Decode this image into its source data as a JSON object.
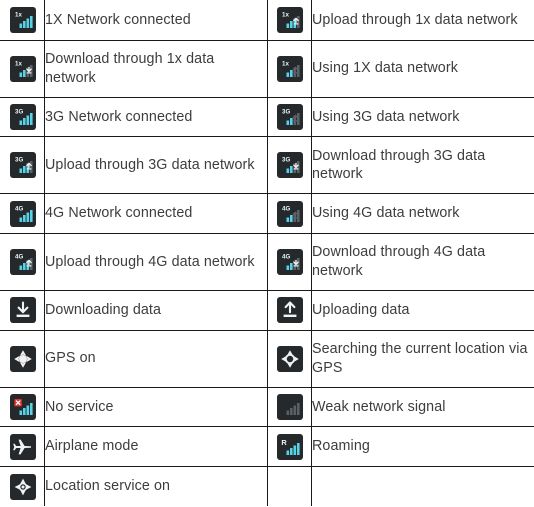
{
  "table": {
    "columns": [
      "icon",
      "description",
      "icon",
      "description"
    ],
    "rows": [
      {
        "left": {
          "icon": "signal-bars-1x-connected-icon",
          "badge": "1x",
          "label": "1X Network connected"
        },
        "right": {
          "icon": "signal-bars-1x-upload-icon",
          "badge": "1x",
          "label": "Upload through 1x data network"
        }
      },
      {
        "left": {
          "icon": "signal-bars-1x-download-icon",
          "badge": "1x",
          "label": "Download through 1x data network"
        },
        "right": {
          "icon": "signal-bars-1x-idle-icon",
          "badge": "1x",
          "label": "Using 1X data network"
        }
      },
      {
        "left": {
          "icon": "signal-bars-3g-connected-icon",
          "badge": "3G",
          "label": "3G Network connected"
        },
        "right": {
          "icon": "signal-bars-3g-idle-icon",
          "badge": "3G",
          "label": "Using 3G data network"
        }
      },
      {
        "left": {
          "icon": "signal-bars-3g-upload-icon",
          "badge": "3G",
          "label": "Upload through 3G data network"
        },
        "right": {
          "icon": "signal-bars-3g-download-icon",
          "badge": "3G",
          "label": "Download through 3G data network"
        }
      },
      {
        "left": {
          "icon": "signal-bars-4g-connected-icon",
          "badge": "4G",
          "label": "4G Network connected"
        },
        "right": {
          "icon": "signal-bars-4g-idle-icon",
          "badge": "4G",
          "label": "Using 4G data network"
        }
      },
      {
        "left": {
          "icon": "signal-bars-4g-upload-icon",
          "badge": "4G",
          "label": "Upload through 4G data network"
        },
        "right": {
          "icon": "signal-bars-4g-download-icon",
          "badge": "4G",
          "label": "Download through 4G data network"
        }
      },
      {
        "left": {
          "icon": "download-arrow-icon",
          "badge": "",
          "label": "Downloading data"
        },
        "right": {
          "icon": "upload-arrow-icon",
          "badge": "",
          "label": "Uploading data"
        }
      },
      {
        "left": {
          "icon": "gps-on-icon",
          "badge": "",
          "label": "GPS on"
        },
        "right": {
          "icon": "gps-searching-icon",
          "badge": "",
          "label": "Searching the current location via GPS"
        }
      },
      {
        "left": {
          "icon": "no-service-icon",
          "badge": "",
          "label": "No service"
        },
        "right": {
          "icon": "weak-signal-icon",
          "badge": "",
          "label": "Weak network signal"
        }
      },
      {
        "left": {
          "icon": "airplane-mode-icon",
          "badge": "",
          "label": "Airplane mode"
        },
        "right": {
          "icon": "roaming-icon",
          "badge": "",
          "label": "Roaming"
        }
      },
      {
        "left": {
          "icon": "location-service-on-icon",
          "badge": "",
          "label": "Location service on"
        },
        "right": {
          "icon": "",
          "badge": "",
          "label": ""
        }
      }
    ]
  },
  "colors": {
    "icon_background": "#26292c",
    "signal_active": "#57d2e6",
    "signal_inactive": "#5a6166",
    "badge_text": "#e8f6fa",
    "text": "#3d3d3f",
    "border": "#1a1a1a",
    "alert_red": "#e0322a",
    "glyph_white": "#f2f2f2",
    "page_background": "#ffffff"
  }
}
